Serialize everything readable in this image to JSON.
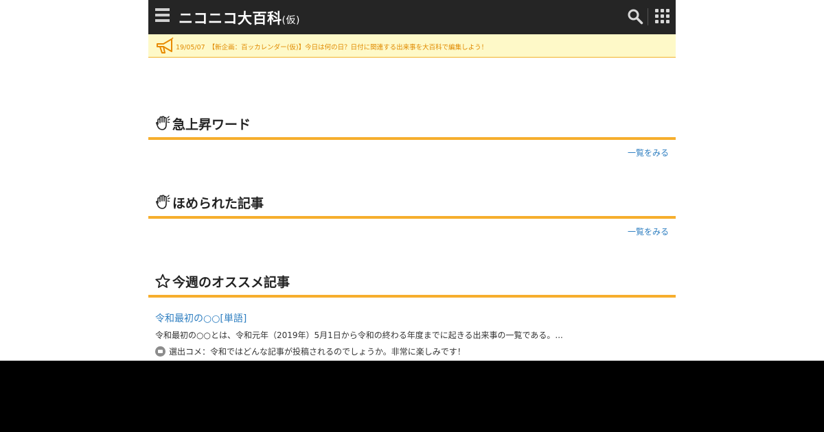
{
  "header": {
    "logo_text": "ニコニコ大百科",
    "logo_suffix": "(仮)",
    "menu_icon": "hamburger-menu-icon",
    "search_icon": "search-icon",
    "apps_icon": "apps-grid-icon"
  },
  "notice": {
    "icon": "megaphone-icon",
    "date": "19/05/07",
    "text": "【新企画：百ッカレンダー(仮)】今日は何の日？日付に関連する出来事を大百科で編集しよう！"
  },
  "sections": [
    {
      "title": "急上昇ワード",
      "icon": "clapping-hand-icon",
      "more_label": "一覧をみる"
    },
    {
      "title": "ほめられた記事",
      "icon": "clapping-hand-icon",
      "more_label": "一覧をみる"
    },
    {
      "title": "今週のオススメ記事",
      "icon": "star-icon",
      "article": {
        "title": "令和最初の○○[単語]",
        "summary": "令和最初の○○とは、令和元年（2019年）5月1日から令和の終わる年度までに起きる出来事の一覧である。...",
        "comment": "選出コメ：令和ではどんな記事が投稿されるのでしょうか。非常に楽しみです！"
      }
    }
  ],
  "colors": {
    "header_bg": "#252525",
    "notice_bg": "#fef9c8",
    "notice_text": "#e08a00",
    "accent": "#f6ae2d",
    "link": "#2f7fc1"
  }
}
